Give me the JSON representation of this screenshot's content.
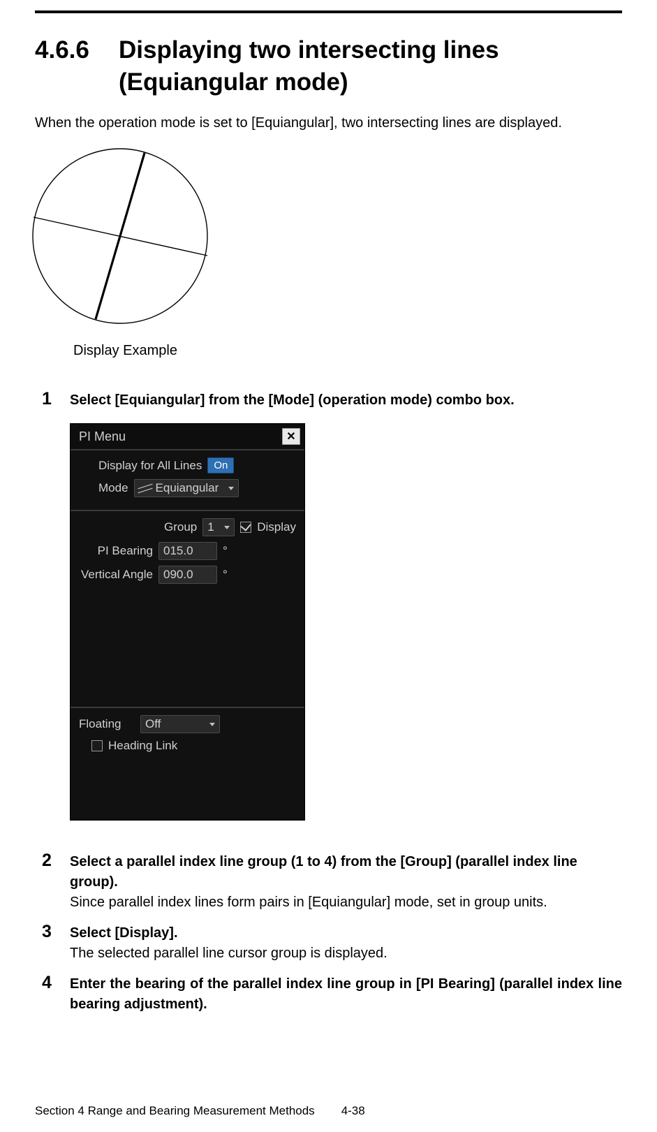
{
  "heading": {
    "number": "4.6.6",
    "title": "Displaying two intersecting lines (Equiangular mode)"
  },
  "intro": "When the operation mode is set to [Equiangular], two intersecting lines are displayed.",
  "display_example_caption": "Display Example",
  "steps": {
    "s1": {
      "num": "1",
      "title": "Select [Equiangular] from the [Mode] (operation mode) combo box."
    },
    "s2": {
      "num": "2",
      "title": "Select a parallel index line group (1 to 4) from the [Group] (parallel index line group).",
      "text": "Since parallel index lines form pairs in [Equiangular] mode, set in group units."
    },
    "s3": {
      "num": "3",
      "title": "Select [Display].",
      "text": "The selected parallel line cursor group is displayed."
    },
    "s4": {
      "num": "4",
      "title": "Enter the bearing of the parallel index line group in [PI Bearing] (parallel index line bearing adjustment)."
    }
  },
  "pi_menu": {
    "title": "PI Menu",
    "close_glyph": "✕",
    "display_all_label": "Display for All Lines",
    "display_all_value": "On",
    "mode_label": "Mode",
    "mode_value": "Equiangular",
    "group_label": "Group",
    "group_value": "1",
    "display_checkbox_label": "Display",
    "pi_bearing_label": "PI Bearing",
    "pi_bearing_value": "015.0",
    "degree": "°",
    "vertical_angle_label": "Vertical Angle",
    "vertical_angle_value": "090.0",
    "floating_label": "Floating",
    "floating_value": "Off",
    "heading_link_label": "Heading Link"
  },
  "footer": {
    "section": "Section 4    Range and Bearing Measurement Methods",
    "page": "4-38"
  }
}
